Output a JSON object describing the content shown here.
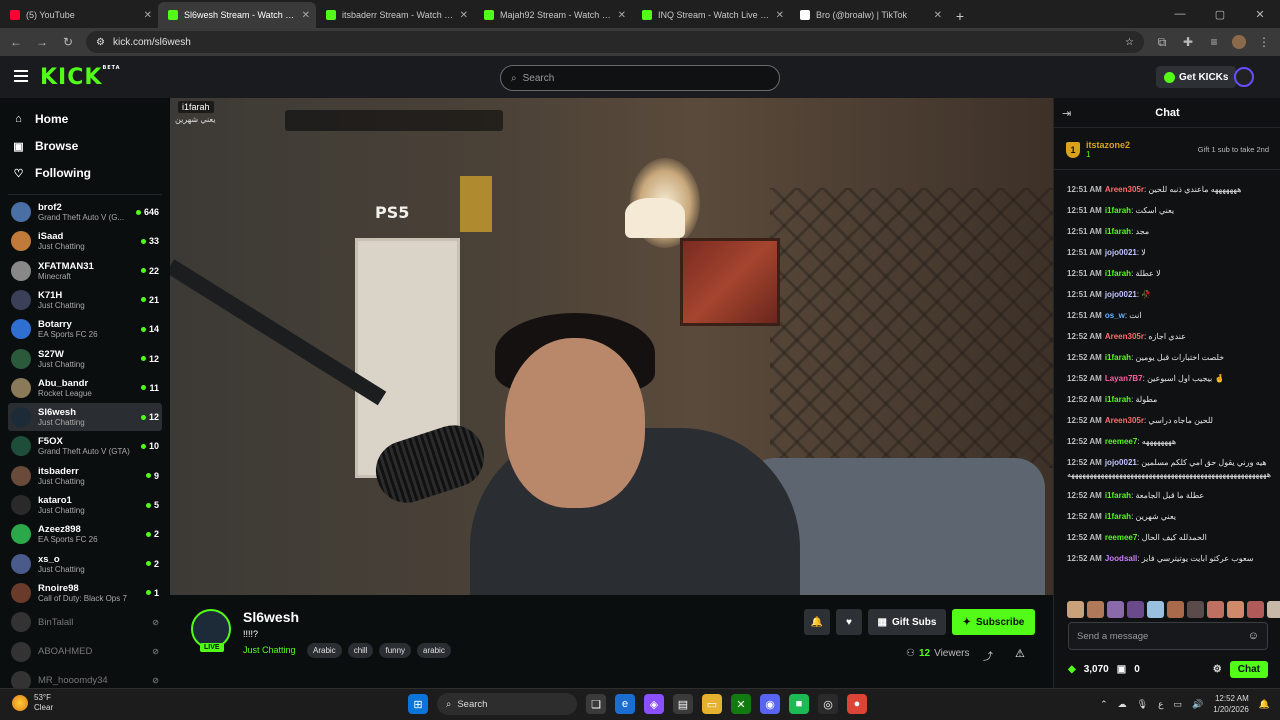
{
  "browser": {
    "tabs": [
      {
        "title": "(5) YouTube",
        "color": "#ff0033",
        "active": false
      },
      {
        "title": "Sl6wesh Stream - Watch Live on Kick",
        "color": "#53fc18",
        "active": true
      },
      {
        "title": "itsbaderr Stream - Watch Live on Kick",
        "color": "#53fc18",
        "active": false
      },
      {
        "title": "Majah92 Stream - Watch Live on Kick",
        "color": "#53fc18",
        "active": false
      },
      {
        "title": "INQ Stream - Watch Live on Kick",
        "color": "#53fc18",
        "active": false
      },
      {
        "title": "Bro (@broalw) | TikTok",
        "color": "#ffffff",
        "active": false
      }
    ],
    "url": "kick.com/sl6wesh"
  },
  "header": {
    "logo": "KICK",
    "logo_badge": "BETA",
    "search_placeholder": "Search",
    "get_kicks": "Get KICKs"
  },
  "sidebar": {
    "nav": [
      {
        "label": "Home",
        "icon": "home-icon"
      },
      {
        "label": "Browse",
        "icon": "browse-icon"
      },
      {
        "label": "Following",
        "icon": "heart-icon"
      }
    ],
    "channels": [
      {
        "name": "brof2",
        "category": "Grand Theft Auto V (G...",
        "viewers": "646",
        "color": "#4a6fa5",
        "online": true,
        "selected": false
      },
      {
        "name": "iSaad",
        "category": "Just Chatting",
        "viewers": "33",
        "color": "#c07a3a",
        "online": true,
        "selected": false
      },
      {
        "name": "XFATMAN31",
        "category": "Minecraft",
        "viewers": "22",
        "color": "#888888",
        "online": true,
        "selected": false
      },
      {
        "name": "K71H",
        "category": "Just Chatting",
        "viewers": "21",
        "color": "#3b3f58",
        "online": true,
        "selected": false
      },
      {
        "name": "Botarry",
        "category": "EA Sports FC 26",
        "viewers": "14",
        "color": "#2f6fd1",
        "online": true,
        "selected": false
      },
      {
        "name": "S27W",
        "category": "Just Chatting",
        "viewers": "12",
        "color": "#2a5a3a",
        "online": true,
        "selected": false
      },
      {
        "name": "Abu_bandr",
        "category": "Rocket League",
        "viewers": "11",
        "color": "#8a7a5a",
        "online": true,
        "selected": false
      },
      {
        "name": "Sl6wesh",
        "category": "Just Chatting",
        "viewers": "12",
        "color": "#1d2a38",
        "online": true,
        "selected": true
      },
      {
        "name": "F5OX",
        "category": "Grand Theft Auto V (GTA)",
        "viewers": "10",
        "color": "#1e4d3a",
        "online": true,
        "selected": false
      },
      {
        "name": "itsbaderr",
        "category": "Just Chatting",
        "viewers": "9",
        "color": "#6a4a3a",
        "online": true,
        "selected": false
      },
      {
        "name": "kataro1",
        "category": "Just Chatting",
        "viewers": "5",
        "color": "#2a2a2a",
        "online": true,
        "selected": false
      },
      {
        "name": "Azeez898",
        "category": "EA Sports FC 26",
        "viewers": "2",
        "color": "#2aa84a",
        "online": true,
        "selected": false
      },
      {
        "name": "xs_o",
        "category": "Just Chatting",
        "viewers": "2",
        "color": "#4a5a8a",
        "online": true,
        "selected": false
      },
      {
        "name": "Rnoire98",
        "category": "Call of Duty: Black Ops 7",
        "viewers": "1",
        "color": "#6a3a2a",
        "online": true,
        "selected": false
      },
      {
        "name": "BinTalall",
        "category": "",
        "viewers": "",
        "color": "#333333",
        "online": false,
        "selected": false
      },
      {
        "name": "ABOAHMED",
        "category": "",
        "viewers": "",
        "color": "#333333",
        "online": false,
        "selected": false
      },
      {
        "name": "MR_hooomdy34",
        "category": "",
        "viewers": "",
        "color": "#333333",
        "online": false,
        "selected": false
      }
    ]
  },
  "video": {
    "overlay_user": "i1farah",
    "overlay_text": "يعني شهرين",
    "scene_text": "PS5"
  },
  "stream": {
    "channel": "Sl6wesh",
    "live_badge": "LIVE",
    "title": "!!!!?",
    "category": "Just Chatting",
    "tags": [
      "Arabic",
      "chill",
      "funny",
      "arabic"
    ],
    "gift_subs": "Gift Subs",
    "subscribe": "Subscribe",
    "viewers": "12",
    "viewers_label": "Viewers"
  },
  "chat": {
    "title": "Chat",
    "pinned": {
      "rank": "1",
      "user": "itstazone2",
      "count": "1",
      "gift_text": "Gift 1 sub to take 2nd"
    },
    "messages": [
      {
        "time": "12:51 AM",
        "user": "Areen305r",
        "color": "#ff6b6b",
        "text": "هههههههه ماعندي ذنبه للحين"
      },
      {
        "time": "12:51 AM",
        "user": "i1farah",
        "color": "#53fc18",
        "text": "يعني اسكت"
      },
      {
        "time": "12:51 AM",
        "user": "i1farah",
        "color": "#53fc18",
        "text": "مجد"
      },
      {
        "time": "12:51 AM",
        "user": "jojo0021",
        "color": "#c4c4ff",
        "text": "لا"
      },
      {
        "time": "12:51 AM",
        "user": "i1farah",
        "color": "#53fc18",
        "text": "لا عطلة"
      },
      {
        "time": "12:51 AM",
        "user": "jojo0021",
        "color": "#c4c4ff",
        "text": "🥀"
      },
      {
        "time": "12:51 AM",
        "user": "os_w",
        "color": "#6ab0ff",
        "text": "انت"
      },
      {
        "time": "12:52 AM",
        "user": "Areen305r",
        "color": "#ff6b6b",
        "text": "عندي اجازه"
      },
      {
        "time": "12:52 AM",
        "user": "i1farah",
        "color": "#53fc18",
        "text": "خلصت اختبارات قبل يومين"
      },
      {
        "time": "12:52 AM",
        "user": "Layan7B7",
        "color": "#ff5fa2",
        "text": "بيجيب اول اسبوعين 🤞"
      },
      {
        "time": "12:52 AM",
        "user": "i1farah",
        "color": "#53fc18",
        "text": "مطولة"
      },
      {
        "time": "12:52 AM",
        "user": "Areen305r",
        "color": "#ff6b6b",
        "text": "للحين ماجاه دراسي"
      },
      {
        "time": "12:52 AM",
        "user": "reemee7",
        "color": "#53fc18",
        "text": "ههههههههه"
      },
      {
        "time": "12:52 AM",
        "user": "jojo0021",
        "color": "#c4c4ff",
        "text": "هيه ورني يقول حق امي كلكم مسلمين ههههههههههههههههههههههههههههههههههههههههههههههههههههههه"
      },
      {
        "time": "12:52 AM",
        "user": "i1farah",
        "color": "#53fc18",
        "text": "عطلة ما قبل الجامعة"
      },
      {
        "time": "12:52 AM",
        "user": "i1farah",
        "color": "#53fc18",
        "text": "يعني شهرين"
      },
      {
        "time": "12:52 AM",
        "user": "reemee7",
        "color": "#53fc18",
        "text": "الحمدلله كيف الحال"
      },
      {
        "time": "12:52 AM",
        "user": "Joodsall",
        "color": "#c77dff",
        "text": "سعوب عركتو ابايت يوتيترسي فايز"
      }
    ],
    "input_placeholder": "Send a message",
    "kicks": "3,070",
    "gifts": "0",
    "send": "Chat"
  },
  "taskbar": {
    "temp": "53°F",
    "weather": "Clear",
    "search": "Search",
    "time": "12:52 AM",
    "date": "1/20/2026"
  }
}
